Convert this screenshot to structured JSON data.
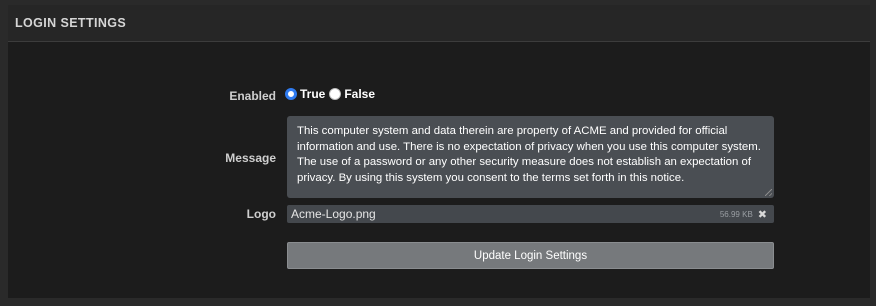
{
  "panel": {
    "title": "LOGIN SETTINGS"
  },
  "enabled": {
    "label": "Enabled",
    "options": [
      {
        "label": "True",
        "selected": true
      },
      {
        "label": "False",
        "selected": false
      }
    ]
  },
  "message": {
    "label": "Message",
    "value": "This computer system and data therein are property of ACME and provided for official information and use. There is no expectation of privacy when you use this computer system. The use of a password or any other security measure does not establish an expectation of privacy. By using this system you consent to the terms set forth in this notice."
  },
  "logo": {
    "label": "Logo",
    "file_name": "Acme-Logo.png",
    "file_size": "56.99 KB",
    "remove_icon": "close-icon"
  },
  "actions": {
    "update_label": "Update Login Settings"
  },
  "colors": {
    "accent": "#2f7bf0",
    "panel_bg": "#1c1c1c",
    "input_bg": "#4a4e53",
    "button_bg": "#76797c"
  }
}
